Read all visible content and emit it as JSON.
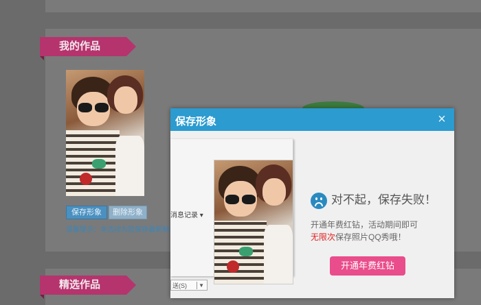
{
  "sections": {
    "works_title": "我的作品",
    "picked_title": "精选作品"
  },
  "works": {
    "save_label": "保存形象",
    "delete_label": "删除形象",
    "tip": "温馨提示：本活动为您保存最新制作"
  },
  "dialog": {
    "title": "保存形象",
    "close_glyph": "×",
    "fail_title": "对不起，保存失败！",
    "line1": "开通年费红钻，活动期间即可",
    "line2_highlight": "无限次",
    "line2_rest": "保存照片QQ秀哦！",
    "button_label": "开通年费红钻"
  },
  "qq_window": {
    "history_label": "消息记录",
    "send_label": "送(S)"
  },
  "colors": {
    "dialog_header": "#2b9bd0",
    "ribbon": "#b5346d",
    "cta": "#e94d8b",
    "highlight": "#e02020"
  }
}
